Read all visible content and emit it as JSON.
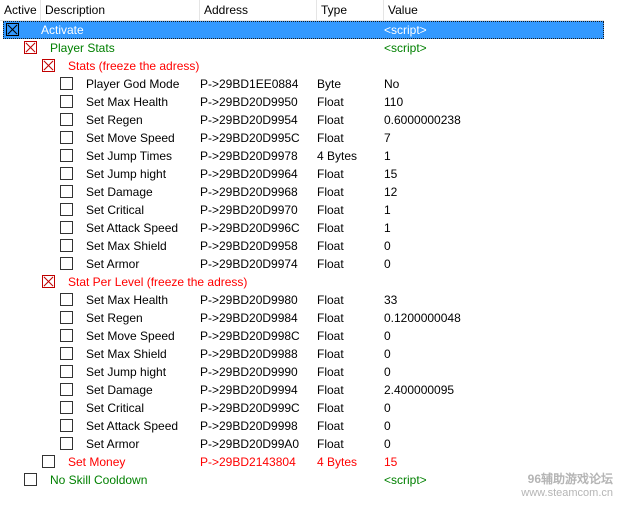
{
  "columns": {
    "active": "Active",
    "description": "Description",
    "address": "Address",
    "type": "Type",
    "value": "Value"
  },
  "rows": [
    {
      "desc": "Activate",
      "addr": "",
      "type": "",
      "value": "<script>",
      "color": "#ffffff",
      "checked": true,
      "selected": true
    },
    {
      "desc": "Player Stats",
      "addr": "",
      "type": "",
      "value": "<script>",
      "color": "#008000",
      "checked": true
    },
    {
      "desc": "Stats (freeze the adress)",
      "addr": "",
      "type": "",
      "value": "",
      "color": "#ff0000",
      "checked": true
    },
    {
      "desc": "Player God Mode",
      "addr": "P->29BD1EE0884",
      "type": "Byte",
      "value": "No",
      "color": "#000000",
      "checked": false
    },
    {
      "desc": "Set Max Health",
      "addr": "P->29BD20D9950",
      "type": "Float",
      "value": "110",
      "color": "#000000",
      "checked": false
    },
    {
      "desc": "Set Regen",
      "addr": "P->29BD20D9954",
      "type": "Float",
      "value": "0.6000000238",
      "color": "#000000",
      "checked": false
    },
    {
      "desc": "Set Move Speed",
      "addr": "P->29BD20D995C",
      "type": "Float",
      "value": "7",
      "color": "#000000",
      "checked": false
    },
    {
      "desc": "Set Jump Times",
      "addr": "P->29BD20D9978",
      "type": "4 Bytes",
      "value": "1",
      "color": "#000000",
      "checked": false
    },
    {
      "desc": "Set Jump hight",
      "addr": "P->29BD20D9964",
      "type": "Float",
      "value": "15",
      "color": "#000000",
      "checked": false
    },
    {
      "desc": "Set Damage",
      "addr": "P->29BD20D9968",
      "type": "Float",
      "value": "12",
      "color": "#000000",
      "checked": false
    },
    {
      "desc": "Set Critical",
      "addr": "P->29BD20D9970",
      "type": "Float",
      "value": "1",
      "color": "#000000",
      "checked": false
    },
    {
      "desc": "Set Attack Speed",
      "addr": "P->29BD20D996C",
      "type": "Float",
      "value": "1",
      "color": "#000000",
      "checked": false
    },
    {
      "desc": "Set Max Shield",
      "addr": "P->29BD20D9958",
      "type": "Float",
      "value": "0",
      "color": "#000000",
      "checked": false
    },
    {
      "desc": "Set Armor",
      "addr": "P->29BD20D9974",
      "type": "Float",
      "value": "0",
      "color": "#000000",
      "checked": false
    },
    {
      "desc": "Stat Per Level (freeze the adress)",
      "addr": "",
      "type": "",
      "value": "",
      "color": "#ff0000",
      "checked": true
    },
    {
      "desc": "Set Max Health",
      "addr": "P->29BD20D9980",
      "type": "Float",
      "value": "33",
      "color": "#000000",
      "checked": false
    },
    {
      "desc": "Set Regen",
      "addr": "P->29BD20D9984",
      "type": "Float",
      "value": "0.1200000048",
      "color": "#000000",
      "checked": false
    },
    {
      "desc": "Set Move Speed",
      "addr": "P->29BD20D998C",
      "type": "Float",
      "value": "0",
      "color": "#000000",
      "checked": false
    },
    {
      "desc": "Set Max Shield",
      "addr": "P->29BD20D9988",
      "type": "Float",
      "value": "0",
      "color": "#000000",
      "checked": false
    },
    {
      "desc": "Set Jump hight",
      "addr": "P->29BD20D9990",
      "type": "Float",
      "value": "0",
      "color": "#000000",
      "checked": false
    },
    {
      "desc": "Set Damage",
      "addr": "P->29BD20D9994",
      "type": "Float",
      "value": "2.400000095",
      "color": "#000000",
      "checked": false
    },
    {
      "desc": "Set Critical",
      "addr": "P->29BD20D999C",
      "type": "Float",
      "value": "0",
      "color": "#000000",
      "checked": false
    },
    {
      "desc": "Set Attack Speed",
      "addr": "P->29BD20D9998",
      "type": "Float",
      "value": "0",
      "color": "#000000",
      "checked": false
    },
    {
      "desc": "Set Armor",
      "addr": "P->29BD20D99A0",
      "type": "Float",
      "value": "0",
      "color": "#000000",
      "checked": false
    },
    {
      "desc": "Set Money",
      "addr": "P->29BD2143804",
      "type": "4 Bytes",
      "value": "15",
      "color": "#ff0000",
      "checked": false
    },
    {
      "desc": "No Skill Cooldown",
      "addr": "",
      "type": "",
      "value": "<script>",
      "color": "#008000",
      "checked": false
    }
  ],
  "watermark": {
    "line1": "96辅助游戏论坛",
    "line2": "www.steamcom.cn"
  }
}
